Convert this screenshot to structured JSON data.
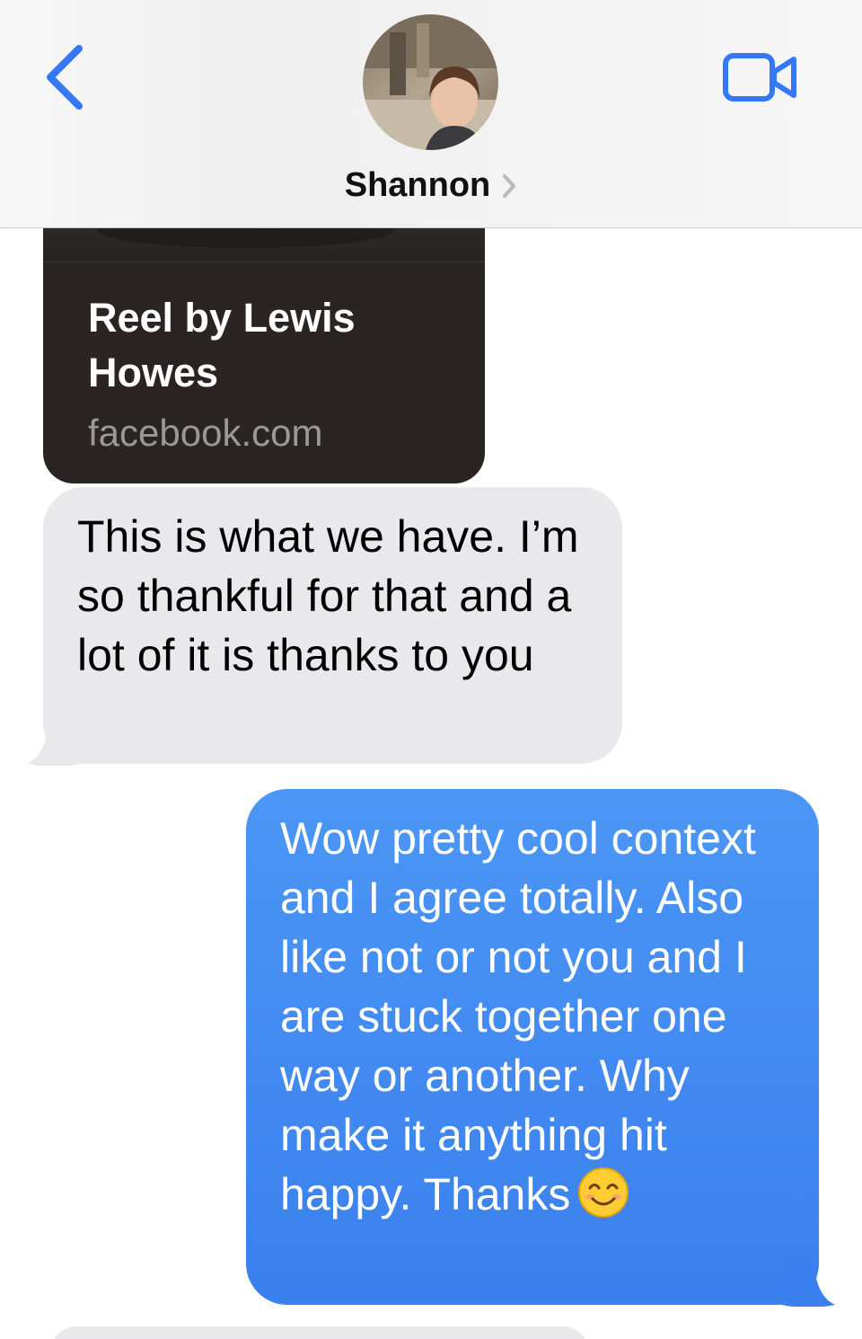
{
  "header": {
    "contact_name": "Shannon",
    "back_icon": "chevron-left-icon",
    "video_icon": "video-camera-icon",
    "accent_color": "#3478f6"
  },
  "messages": [
    {
      "type": "link-preview",
      "direction": "incoming",
      "title": "Reel by Lewis Howes",
      "domain": "facebook.com"
    },
    {
      "type": "text",
      "direction": "incoming",
      "text": "This is what we have. I’m so thankful for that and a lot of it is thanks to you"
    },
    {
      "type": "text",
      "direction": "outgoing",
      "text": "Wow pretty cool context and I agree totally.  Also like not or not you and I are stuck together one way or another.  Why make it anything hit happy.  Thanks",
      "emoji": "smiling-face-emoji"
    }
  ],
  "colors": {
    "incoming_bubble": "#e9e9eb",
    "outgoing_bubble": "#3a80ee",
    "link_card": "#2a2523"
  }
}
